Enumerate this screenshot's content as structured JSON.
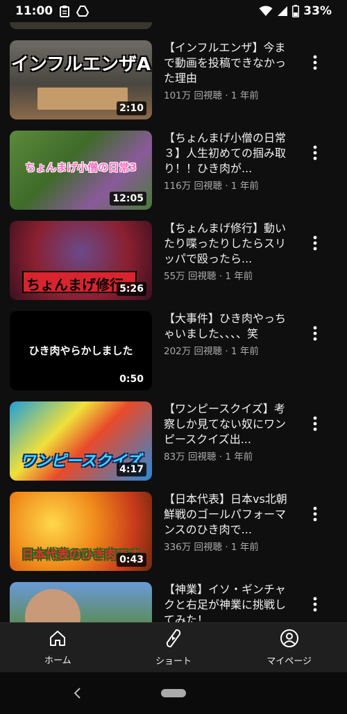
{
  "status_bar": {
    "time": "11:00",
    "battery": "33%",
    "icons": [
      "clipboard-icon",
      "drive-icon",
      "wifi-icon",
      "signal-icon",
      "battery-icon"
    ]
  },
  "videos": [
    {
      "thumb_text": "インフルエンザA",
      "duration": "2:10",
      "title": "【インフルエンザ】今まで動画を投稿できなかった理由",
      "meta": "101万 回視聴 · 1 年前"
    },
    {
      "thumb_text": "ちょんまげ小僧の日常3",
      "duration": "12:05",
      "title": "【ちょんまげ小僧の日常３】人生初めての掴み取り！！ひき肉が...",
      "meta": "116万 回視聴 · 1 年前"
    },
    {
      "thumb_text": "ちょんまげ修行",
      "duration": "5:26",
      "title": "【ちょんまげ修行】動いたり喋ったりしたらスリッパで殴ったら...",
      "meta": "55万 回視聴 · 1 年前"
    },
    {
      "thumb_text": "ひき肉やらかしました",
      "duration": "0:50",
      "title": "【大事件】ひき肉やっちゃいました、、、、笑",
      "meta": "202万 回視聴 · 1 年前"
    },
    {
      "thumb_text": "ワンピースクイズ",
      "duration": "4:17",
      "title": "【ワンピースクイズ】考察しか見てない奴にワンピースクイズ出...",
      "meta": "83万 回視聴 · 1 年前"
    },
    {
      "thumb_text": "日本代表のひき肉です",
      "duration": "0:43",
      "title": "【日本代表】日本vs北朝鮮戦のゴールパフォーマンスのひき肉で...",
      "meta": "336万 回視聴 · 1 年前"
    },
    {
      "thumb_text": "",
      "duration": "",
      "title": "【神業】イソ・ギンチャクと右足が神業に挑戦してみた！",
      "meta": ""
    }
  ],
  "bottom_nav": {
    "home": "ホーム",
    "shorts": "ショート",
    "mypage": "マイページ"
  },
  "colors": {
    "background": "#0f0f0f",
    "nav_background": "#1f1f1f",
    "text_primary": "#f1f1f1",
    "text_secondary": "#aaaaaa"
  }
}
